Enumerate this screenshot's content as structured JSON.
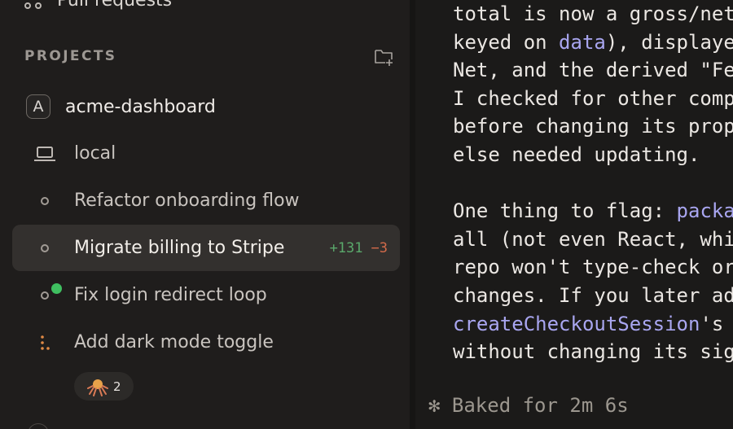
{
  "sidebar": {
    "top_item_label": "Pull requests",
    "projects_title": "PROJECTS",
    "project": {
      "avatar_letter": "A",
      "name": "acme-dashboard"
    },
    "items": [
      {
        "label": "local",
        "icon": "laptop-icon"
      },
      {
        "label": "Refactor onboarding flow",
        "icon": "ring-icon"
      },
      {
        "label": "Migrate billing to Stripe",
        "icon": "ring-icon",
        "selected": true,
        "additions": "+131",
        "deletions": "−3"
      },
      {
        "label": "Fix login redirect loop",
        "icon": "ring-icon",
        "status": "green-dot"
      },
      {
        "label": "Add dark mode toggle",
        "icon": "dots-icon"
      }
    ],
    "agent_chip_count": "2"
  },
  "terminal": {
    "lines": [
      [
        {
          "t": "total is now a gross/net"
        }
      ],
      [
        {
          "t": "keyed on "
        },
        {
          "t": "data",
          "code": true
        },
        {
          "t": "), displaye"
        }
      ],
      [
        {
          "t": "Net, and the derived \"Fe"
        }
      ],
      [
        {
          "t": "I checked for other comp"
        }
      ],
      [
        {
          "t": "before changing its prop"
        }
      ],
      [
        {
          "t": "else needed updating."
        }
      ],
      [
        {
          "t": ""
        }
      ],
      [
        {
          "t": "One thing to flag: "
        },
        {
          "t": "packa",
          "code": true
        }
      ],
      [
        {
          "t": "all (not even React, whi"
        }
      ],
      [
        {
          "t": "repo won't type-check or"
        }
      ],
      [
        {
          "t": "changes. If you later ad"
        }
      ],
      [
        {
          "t": "createCheckoutSession",
          "code": true
        },
        {
          "t": "'s"
        }
      ],
      [
        {
          "t": "without changing its sig"
        }
      ]
    ],
    "status": "✻ Baked for 2m 6s"
  },
  "colors": {
    "accent_code": "#a9a6f0",
    "diff_add": "#5aa86b",
    "diff_del": "#d26a4a",
    "status_green": "#3fbf60"
  }
}
